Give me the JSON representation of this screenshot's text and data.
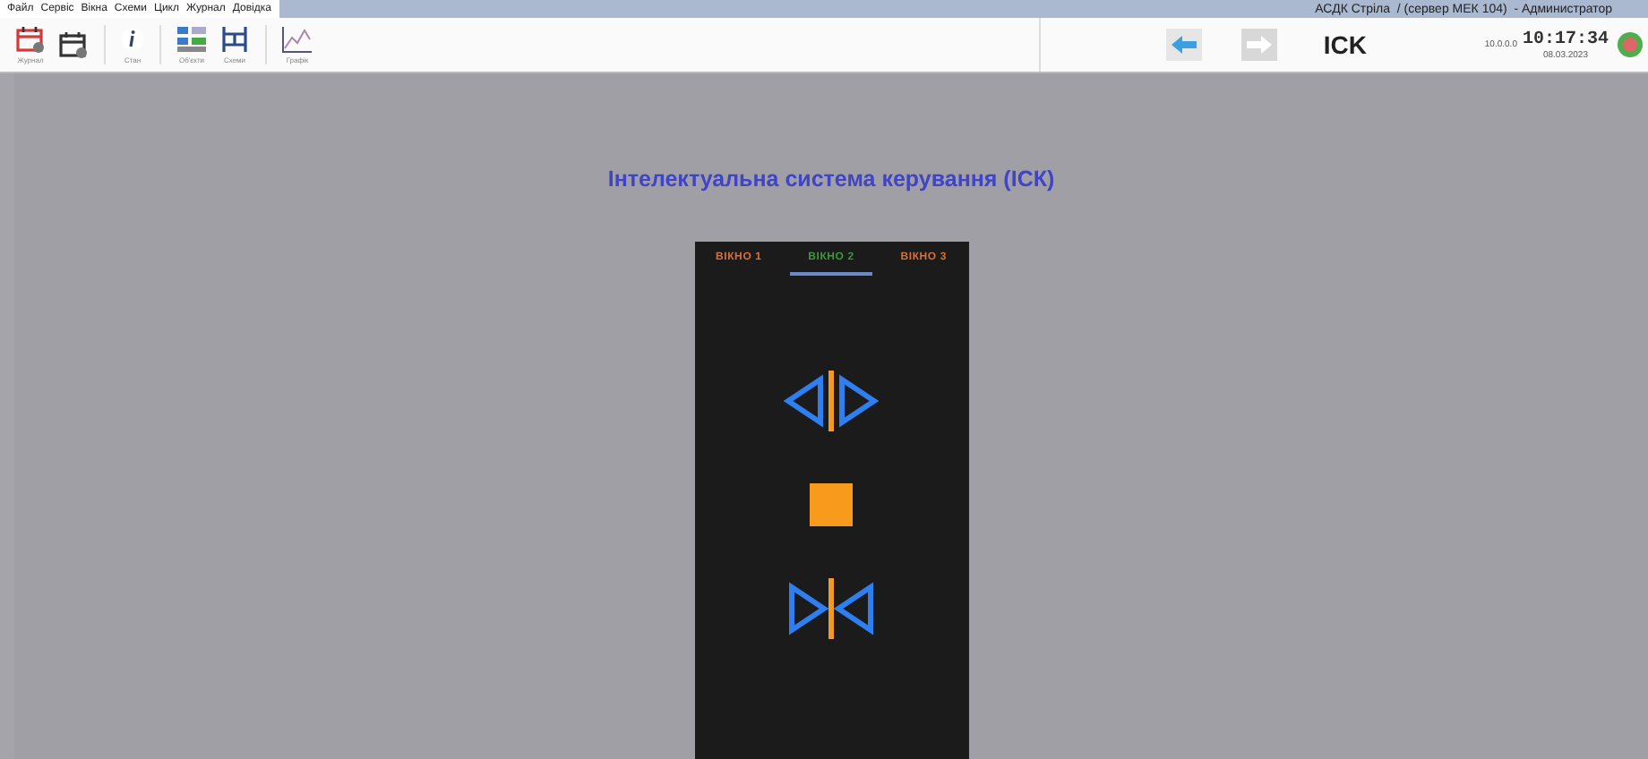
{
  "menu": [
    "Файл",
    "Сервіс",
    "Вікна",
    "Схеми",
    "Цикл",
    "Журнал",
    "Довідка"
  ],
  "app_title": "АСДК Стріла  / (сервер МЕК 104)  - Администратор",
  "toolbar": [
    {
      "kind": "calendar-red",
      "label": "Журнал"
    },
    {
      "kind": "calendar"
    },
    {
      "kind": "info",
      "label": "Стан"
    },
    {
      "kind": "objects",
      "label": "Об'єкти"
    },
    {
      "kind": "scheme",
      "label": "Схеми"
    },
    {
      "kind": "chart",
      "label": "Графік"
    }
  ],
  "nav": [
    {
      "kind": "back",
      "disabled": false
    },
    {
      "kind": "forward",
      "disabled": true
    }
  ],
  "screen_name": "ICK",
  "ip": "10.0.0.0",
  "time": "10:17:34",
  "date": "08.03.2023",
  "page_title": "Інтелектуальна система керування (ІСК)",
  "tabs": [
    {
      "label": "ВІКНО 1",
      "selected": false
    },
    {
      "label": "ВІКНО 2",
      "selected": true
    },
    {
      "label": "ВІКНО 3",
      "selected": false
    }
  ],
  "controls": [
    {
      "kind": "open"
    },
    {
      "kind": "stop"
    },
    {
      "kind": "close"
    }
  ]
}
